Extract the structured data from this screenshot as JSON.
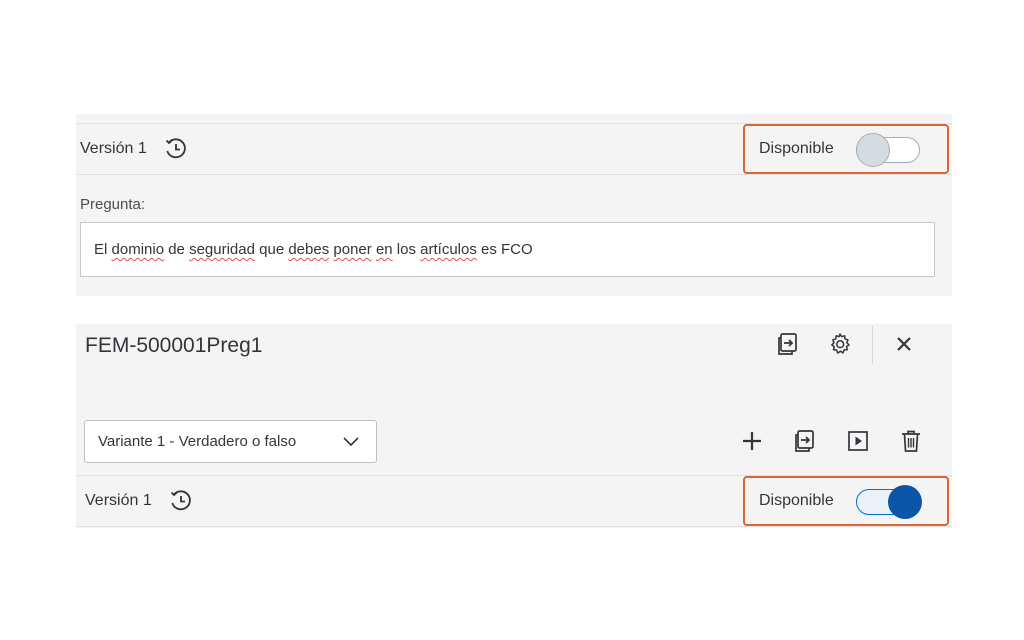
{
  "top_panel": {
    "version_label": "Versión 1",
    "available_label": "Disponible",
    "available_on": false,
    "question_label": "Pregunta:",
    "question_segments": [
      {
        "text": "El ",
        "flag": false
      },
      {
        "text": "dominio",
        "flag": true
      },
      {
        "text": " de ",
        "flag": false
      },
      {
        "text": "seguridad",
        "flag": true
      },
      {
        "text": " que ",
        "flag": false
      },
      {
        "text": "debes",
        "flag": true
      },
      {
        "text": " ",
        "flag": false
      },
      {
        "text": "poner",
        "flag": true
      },
      {
        "text": " ",
        "flag": false
      },
      {
        "text": "en",
        "flag": true
      },
      {
        "text": " los ",
        "flag": false
      },
      {
        "text": "artículos",
        "flag": true
      },
      {
        "text": " es FCO",
        "flag": false
      }
    ]
  },
  "bottom_panel": {
    "title": "FEM-500001Preg1",
    "variant_select": "Variante 1 - Verdadero o falso",
    "version_label": "Versión 1",
    "available_label": "Disponible",
    "available_on": true
  },
  "colors": {
    "highlight_border": "#d9663b",
    "toggle_on": "#0a55a6",
    "panel_bg": "#f4f4f4"
  },
  "icons": {
    "history": "history-icon",
    "duplicate": "duplicate-icon",
    "settings": "gear-icon",
    "close": "close-icon",
    "add": "plus-icon",
    "preview": "play-icon",
    "delete": "trash-icon",
    "dropdown": "chevron-down-icon"
  }
}
